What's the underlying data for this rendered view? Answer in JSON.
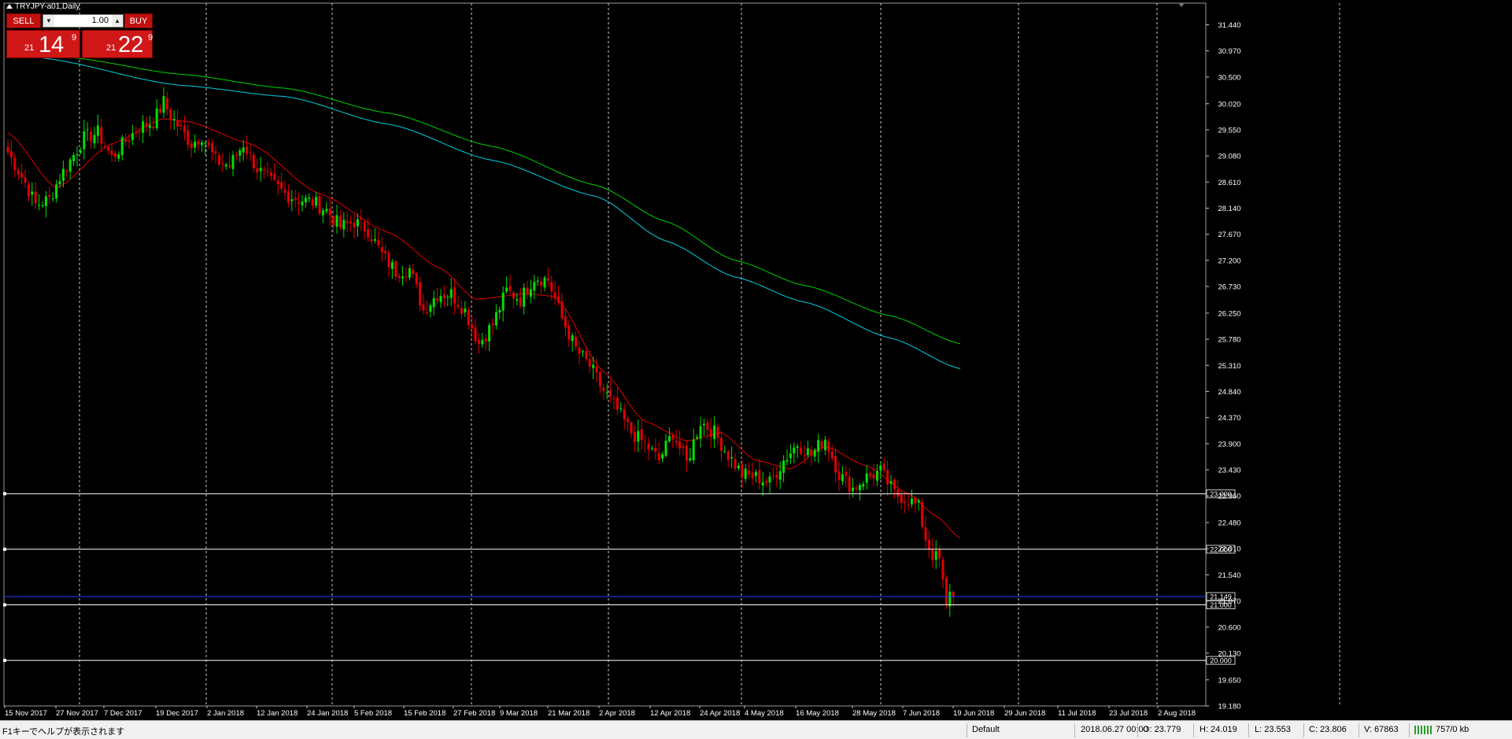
{
  "window": {
    "title": "TRYJPY-a01,Daily"
  },
  "trade_panel": {
    "sell_label": "SELL",
    "buy_label": "BUY",
    "lot_value": "1.00",
    "sell_price": {
      "prefix": "21",
      "big": "14",
      "sup": "9"
    },
    "buy_price": {
      "prefix": "21",
      "big": "22",
      "sup": "9"
    }
  },
  "colors": {
    "background": "#000000",
    "bull_candle": "#00e000",
    "bear_candle": "#e00000",
    "ema_fast": "#e00000",
    "ma_green": "#00d000",
    "ma_cyan": "#00d0e0",
    "current_price_line": "#2040ff",
    "horizontal_levels": "#ffffff",
    "button_red": "#c01010"
  },
  "status_bar": {
    "help": "F1キーでヘルプが表示されます",
    "profile": "Default",
    "datetime": "2018.06.27 00:00",
    "open": "O: 23.779",
    "high": "H: 24.019",
    "low": "L: 23.553",
    "close": "C: 23.806",
    "volume": "V: 67863",
    "traffic": "757/0 kb"
  },
  "chart_data": {
    "type": "candlestick",
    "symbol": "TRYJPY-a01",
    "timeframe": "Daily",
    "ylim": [
      19.18,
      31.83
    ],
    "y_ticks": [
      "31.440",
      "30.970",
      "30.500",
      "30.020",
      "29.550",
      "29.080",
      "28.610",
      "28.140",
      "27.670",
      "27.200",
      "26.730",
      "26.250",
      "25.780",
      "25.310",
      "24.840",
      "24.370",
      "23.900",
      "23.430",
      "22.960",
      "22.480",
      "22.010",
      "21.540",
      "21.070",
      "20.600",
      "20.130",
      "19.650",
      "19.180"
    ],
    "x_ticks": [
      "15 Nov 2017",
      "27 Nov 2017",
      "7 Dec 2017",
      "19 Dec 2017",
      "2 Jan 2018",
      "12 Jan 2018",
      "24 Jan 2018",
      "5 Feb 2018",
      "15 Feb 2018",
      "27 Feb 2018",
      "9 Mar 2018",
      "21 Mar 2018",
      "2 Apr 2018",
      "12 Apr 2018",
      "24 Apr 2018",
      "4 May 2018",
      "16 May 2018",
      "28 May 2018",
      "7 Jun 2018",
      "19 Jun 2018",
      "29 Jun 2018",
      "11 Jul 2018",
      "23 Jul 2018",
      "2 Aug 2018"
    ],
    "horizontal_levels": [
      {
        "value": 23.0,
        "label": "23.000"
      },
      {
        "value": 22.0,
        "label": "22.000"
      },
      {
        "value": 21.0,
        "label": "21.000"
      },
      {
        "value": 20.0,
        "label": "20.000"
      }
    ],
    "current_price": {
      "value": 21.149,
      "label": "21.149"
    },
    "anchors": [
      {
        "i": 0,
        "c": 29.15
      },
      {
        "i": 5,
        "c": 28.6
      },
      {
        "i": 8,
        "c": 28.2
      },
      {
        "i": 12,
        "c": 28.3
      },
      {
        "i": 15,
        "c": 28.7
      },
      {
        "i": 18,
        "c": 29.0
      },
      {
        "i": 22,
        "c": 29.4
      },
      {
        "i": 26,
        "c": 29.5
      },
      {
        "i": 30,
        "c": 29.05
      },
      {
        "i": 34,
        "c": 29.35
      },
      {
        "i": 38,
        "c": 29.6
      },
      {
        "i": 42,
        "c": 29.7
      },
      {
        "i": 45,
        "c": 30.05
      },
      {
        "i": 47,
        "c": 29.8
      },
      {
        "i": 50,
        "c": 29.55
      },
      {
        "i": 53,
        "c": 29.3
      },
      {
        "i": 56,
        "c": 29.45
      },
      {
        "i": 60,
        "c": 29.0
      },
      {
        "i": 64,
        "c": 28.9
      },
      {
        "i": 68,
        "c": 29.3
      },
      {
        "i": 72,
        "c": 28.85
      },
      {
        "i": 76,
        "c": 28.6
      },
      {
        "i": 80,
        "c": 28.4
      },
      {
        "i": 84,
        "c": 28.3
      },
      {
        "i": 88,
        "c": 28.25
      },
      {
        "i": 92,
        "c": 28.1
      },
      {
        "i": 96,
        "c": 27.8
      },
      {
        "i": 100,
        "c": 27.9
      },
      {
        "i": 104,
        "c": 27.75
      },
      {
        "i": 108,
        "c": 27.3
      },
      {
        "i": 112,
        "c": 27.0
      },
      {
        "i": 116,
        "c": 27.05
      },
      {
        "i": 120,
        "c": 26.3
      },
      {
        "i": 124,
        "c": 26.6
      },
      {
        "i": 128,
        "c": 26.6
      },
      {
        "i": 132,
        "c": 26.3
      },
      {
        "i": 136,
        "c": 25.7
      },
      {
        "i": 140,
        "c": 26.05
      },
      {
        "i": 144,
        "c": 26.65
      },
      {
        "i": 148,
        "c": 26.5
      },
      {
        "i": 152,
        "c": 26.9
      },
      {
        "i": 156,
        "c": 26.85
      },
      {
        "i": 160,
        "c": 26.15
      },
      {
        "i": 164,
        "c": 25.6
      },
      {
        "i": 168,
        "c": 25.3
      },
      {
        "i": 172,
        "c": 24.85
      },
      {
        "i": 176,
        "c": 24.5
      },
      {
        "i": 180,
        "c": 24.1
      },
      {
        "i": 184,
        "c": 23.9
      },
      {
        "i": 188,
        "c": 23.6
      },
      {
        "i": 192,
        "c": 24.1
      },
      {
        "i": 196,
        "c": 23.55
      },
      {
        "i": 200,
        "c": 24.3
      },
      {
        "i": 204,
        "c": 24.1
      },
      {
        "i": 208,
        "c": 23.7
      },
      {
        "i": 212,
        "c": 23.35
      },
      {
        "i": 216,
        "c": 23.3
      },
      {
        "i": 220,
        "c": 23.2
      },
      {
        "i": 224,
        "c": 23.6
      },
      {
        "i": 228,
        "c": 23.9
      },
      {
        "i": 232,
        "c": 23.7
      },
      {
        "i": 236,
        "c": 24.0
      },
      {
        "i": 240,
        "c": 23.35
      },
      {
        "i": 244,
        "c": 23.1
      },
      {
        "i": 248,
        "c": 23.3
      },
      {
        "i": 252,
        "c": 23.4
      },
      {
        "i": 256,
        "c": 23.0
      },
      {
        "i": 260,
        "c": 22.9
      },
      {
        "i": 263,
        "c": 22.75
      },
      {
        "i": 265,
        "c": 22.2
      },
      {
        "i": 267,
        "c": 21.9
      },
      {
        "i": 269,
        "c": 21.8
      },
      {
        "i": 271,
        "c": 20.95
      },
      {
        "i": 272,
        "c": 21.3
      },
      {
        "i": 273,
        "c": 21.15
      }
    ],
    "ema_fast": [
      [
        0,
        29.5
      ],
      [
        14,
        28.5
      ],
      [
        30,
        29.3
      ],
      [
        45,
        29.75
      ],
      [
        52,
        29.7
      ],
      [
        70,
        29.3
      ],
      [
        90,
        28.4
      ],
      [
        110,
        27.7
      ],
      [
        125,
        27.05
      ],
      [
        135,
        26.5
      ],
      [
        150,
        26.6
      ],
      [
        158,
        26.55
      ],
      [
        172,
        25.2
      ],
      [
        184,
        24.3
      ],
      [
        196,
        23.95
      ],
      [
        206,
        24.1
      ],
      [
        216,
        23.6
      ],
      [
        226,
        23.45
      ],
      [
        236,
        23.85
      ],
      [
        248,
        23.5
      ],
      [
        260,
        23.0
      ],
      [
        268,
        22.6
      ],
      [
        275,
        22.2
      ]
    ],
    "ma_green": [
      [
        18,
        30.85
      ],
      [
        50,
        30.55
      ],
      [
        80,
        30.3
      ],
      [
        110,
        29.85
      ],
      [
        140,
        29.25
      ],
      [
        170,
        28.55
      ],
      [
        190,
        27.9
      ],
      [
        210,
        27.2
      ],
      [
        230,
        26.75
      ],
      [
        255,
        26.2
      ],
      [
        275,
        25.7
      ]
    ],
    "ma_cyan": [
      [
        9,
        30.85
      ],
      [
        50,
        30.35
      ],
      [
        80,
        30.15
      ],
      [
        110,
        29.65
      ],
      [
        140,
        29.0
      ],
      [
        170,
        28.35
      ],
      [
        190,
        27.55
      ],
      [
        210,
        26.9
      ],
      [
        230,
        26.45
      ],
      [
        255,
        25.8
      ],
      [
        275,
        25.25
      ]
    ]
  }
}
